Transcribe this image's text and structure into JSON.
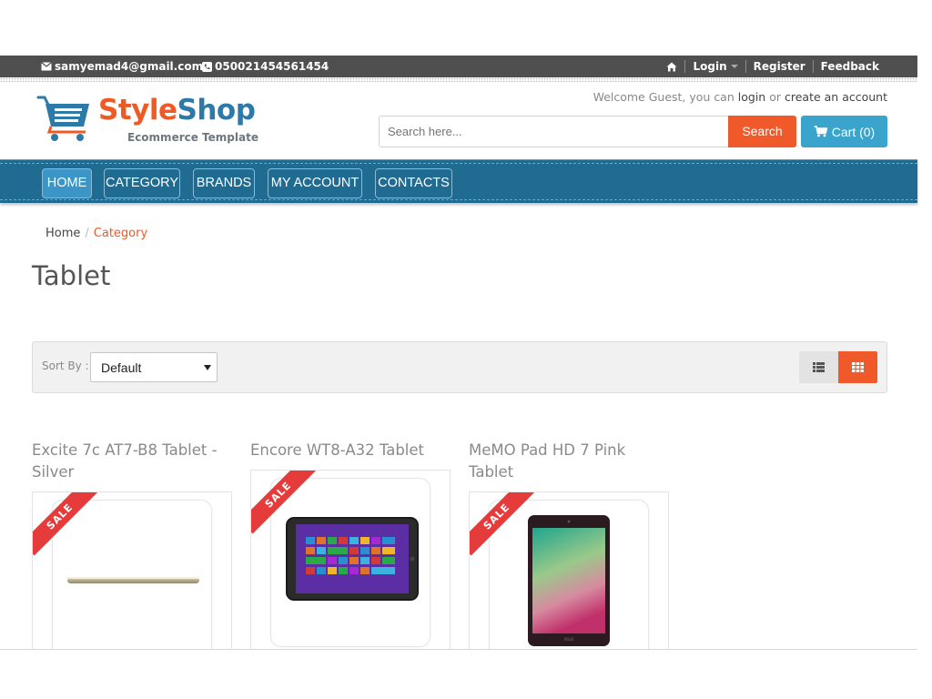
{
  "topbar": {
    "email": "samyemad4@gmail.com",
    "phone": "050021454561454",
    "login": "Login",
    "register": "Register",
    "feedback": "Feedback"
  },
  "header": {
    "logo_part1": "Style",
    "logo_part2": "Shop",
    "logo_tagline": "Ecommerce Template",
    "welcome_prefix": "Welcome Guest, you can",
    "welcome_login": "login",
    "welcome_or": "or",
    "welcome_create": "create an account",
    "search_placeholder": "Search here...",
    "search_button": "Search",
    "cart_label": "Cart (0)"
  },
  "nav": {
    "items": [
      {
        "label": "HOME",
        "active": true
      },
      {
        "label": "CATEGORY",
        "active": false
      },
      {
        "label": "BRANDS",
        "active": false
      },
      {
        "label": "MY ACCOUNT",
        "active": false
      },
      {
        "label": "CONTACTS",
        "active": false
      }
    ]
  },
  "breadcrumb": {
    "home": "Home",
    "divider": "/",
    "current": "Category"
  },
  "page_title": "Tablet",
  "sortbar": {
    "label": "Sort By :",
    "selected": "Default"
  },
  "products": [
    {
      "title": "Excite 7c AT7-B8 Tablet - Silver",
      "badge": "SALE"
    },
    {
      "title": "Encore WT8-A32 Tablet",
      "badge": "SALE"
    },
    {
      "title": "MeMO Pad HD 7 Pink Tablet",
      "badge": "SALE"
    }
  ],
  "colors": {
    "accent_orange": "#f0592a",
    "nav_blue": "#1f6b92",
    "cart_blue": "#3aa4cc",
    "sale_red": "#e53b3b"
  }
}
